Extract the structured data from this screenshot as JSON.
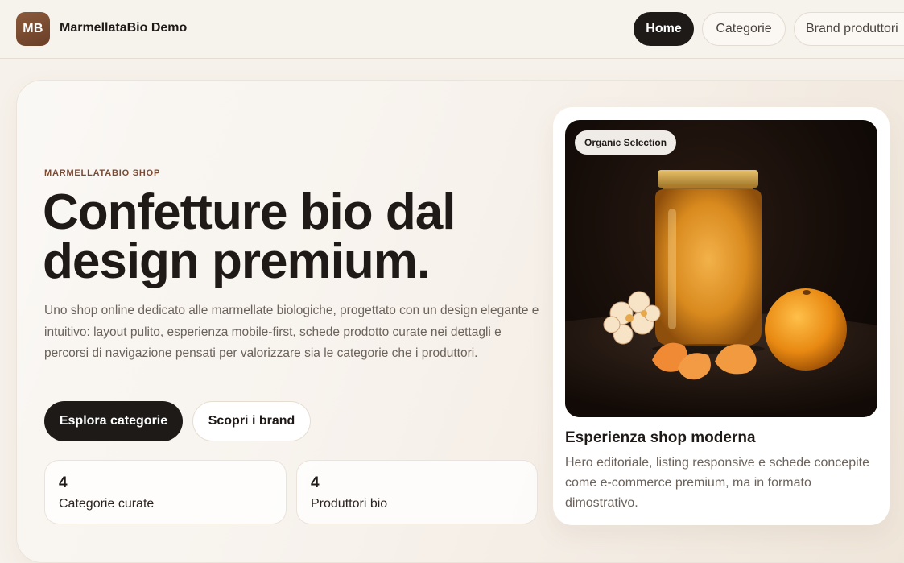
{
  "header": {
    "logo_initials": "MB",
    "brand_name": "MarmellataBio Demo",
    "nav": [
      {
        "label": "Home",
        "active": true
      },
      {
        "label": "Categorie",
        "active": false
      },
      {
        "label": "Brand produttori",
        "active": false
      }
    ]
  },
  "hero": {
    "eyebrow": "MARMELLATABIO SHOP",
    "headline": "Confetture bio dal design premium.",
    "lead": "Uno shop online dedicato alle marmellate biologiche, progettato con un design elegante e intuitivo: layout pulito, esperienza mobile-first, schede prodotto curate nei dettagli e percorsi di navigazione pensati per valorizzare sia le categorie che i produttori.",
    "primary_button": "Esplora categorie",
    "secondary_button": "Scopri i brand",
    "stats": [
      {
        "value": "4",
        "label": "Categorie curate"
      },
      {
        "value": "4",
        "label": "Produttori bio"
      }
    ]
  },
  "feature_card": {
    "badge": "Organic Selection",
    "title": "Esperienza shop moderna",
    "text": "Hero editoriale, listing responsive e schede concepite come e-commerce premium, ma in formato dimostrativo."
  },
  "colors": {
    "accent_dark": "#1d1a18",
    "brand_brown": "#7a4a33",
    "background": "#f6f1ea"
  }
}
